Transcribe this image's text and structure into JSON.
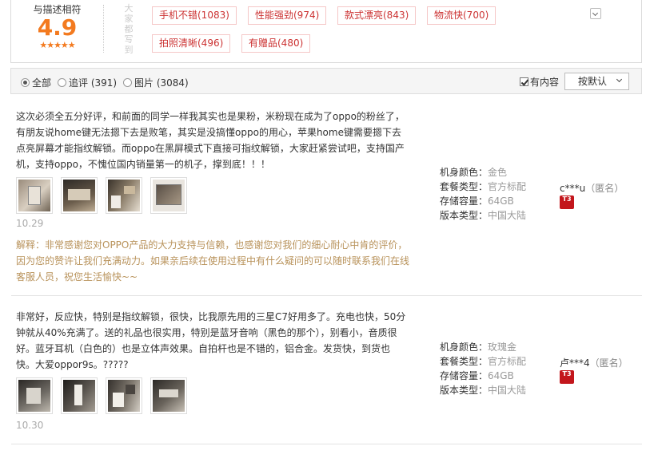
{
  "summary": {
    "score_label": "与描述相符",
    "score": "4.9",
    "stars": "★★★★★",
    "vertical_label": "大家都写到",
    "tags": [
      {
        "label": "手机不错(1083)"
      },
      {
        "label": "性能强劲(974)"
      },
      {
        "label": "款式漂亮(843)"
      },
      {
        "label": "物流快(700)"
      },
      {
        "label": "拍照清晰(496)"
      },
      {
        "label": "有赠品(480)"
      }
    ]
  },
  "filter": {
    "options": [
      {
        "label": "全部",
        "selected": true
      },
      {
        "label": "追评 (391)",
        "selected": false
      },
      {
        "label": "图片 (3084)",
        "selected": false
      }
    ],
    "has_content_label": "有内容",
    "has_content_checked": true,
    "sort_label": "按默认"
  },
  "reviews": [
    {
      "text": "这次必须全五分好评，和前面的同学一样我其实也是果粉，米粉现在成为了oppo的粉丝了，有朋友说home键无法摁下去是败笔，其实是没搞懂oppo的用心，苹果home键需要摁下去点亮屏幕才能指纹解锁。而oppo在黑屏模式下直接可指纹解锁，大家赶紧尝试吧，支持国产机，支持oppo，不愧位国内销量第一的机子，撑到底！！！",
      "date": "10.29",
      "reply": "解释：非常感谢您对OPPO产品的大力支持与信赖，也感谢您对我们的细心耐心中肯的评价，因为您的赞许让我们充满动力。如果亲后续在使用过程中有什么疑问的可以随时联系我们在线客服人员，祝您生活愉快~~",
      "specs": [
        {
          "key": "机身颜色：",
          "value": "金色"
        },
        {
          "key": "套餐类型：",
          "value": "官方标配"
        },
        {
          "key": "存储容量：",
          "value": "64GB"
        },
        {
          "key": "版本类型：",
          "value": "中国大陆"
        }
      ],
      "user": "c***u",
      "anon": "（匿名）",
      "badge": "T3"
    },
    {
      "text": "非常好，反应快，特别是指纹解锁，很快，比我原先用的三星C7好用多了。充电也快，50分钟就从40%充满了。送的礼品也很实用，特别是蓝牙音响（黑色的那个），别看小，音质很好。蓝牙耳机（白色的）也是立体声效果。自拍杆也是不错的，铝合金。发货快，到货也快。大爱oppor9s。?????",
      "date": "10.30",
      "specs": [
        {
          "key": "机身颜色：",
          "value": "玫瑰金"
        },
        {
          "key": "套餐类型：",
          "value": "官方标配"
        },
        {
          "key": "存储容量：",
          "value": "64GB"
        },
        {
          "key": "版本类型：",
          "value": "中国大陆"
        }
      ],
      "user": "卢***4",
      "anon": "（匿名）",
      "badge": "T3"
    }
  ],
  "colors": {
    "accent": "#f37a1f",
    "tag_text": "#cc3333",
    "reply_text": "#b8925a",
    "badge": "#c3161c"
  }
}
